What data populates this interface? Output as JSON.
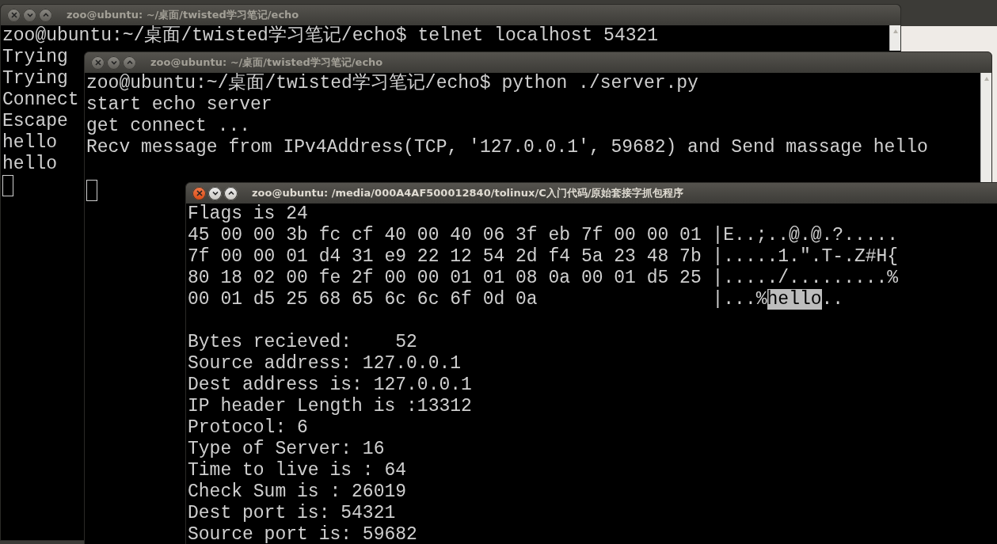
{
  "windows": [
    {
      "title": "zoo@ubuntu: ~/桌面/twisted学习笔记/echo",
      "active": false,
      "lines": [
        {
          "kind": "text",
          "text": "zoo@ubuntu:~/桌面/twisted学习笔记/echo$ telnet localhost 54321"
        },
        {
          "kind": "text",
          "text": "Trying"
        },
        {
          "kind": "text",
          "text": "Trying"
        },
        {
          "kind": "text",
          "text": "Connect"
        },
        {
          "kind": "text",
          "text": "Escape"
        },
        {
          "kind": "text",
          "text": "hello"
        },
        {
          "kind": "text",
          "text": "hello"
        },
        {
          "kind": "cursor"
        }
      ]
    },
    {
      "title": "zoo@ubuntu: ~/桌面/twisted学习笔记/echo",
      "active": false,
      "lines": [
        {
          "kind": "text",
          "text": "zoo@ubuntu:~/桌面/twisted学习笔记/echo$ python ./server.py"
        },
        {
          "kind": "text",
          "text": "start echo server"
        },
        {
          "kind": "text",
          "text": "get connect ..."
        },
        {
          "kind": "text",
          "text": "Recv message from IPv4Address(TCP, '127.0.0.1', 59682) and Send massage hello"
        },
        {
          "kind": "blank"
        },
        {
          "kind": "cursor"
        }
      ]
    },
    {
      "title": "zoo@ubuntu: /media/000A4AF500012840/tolinux/C入门代码/原始套接字抓包程序",
      "active": true,
      "lines": [
        {
          "kind": "text",
          "text": "Flags is 24"
        },
        {
          "kind": "text",
          "text": "45 00 00 3b fc cf 40 00 40 06 3f eb 7f 00 00 01 |E..;..@.@.?....."
        },
        {
          "kind": "text",
          "text": "7f 00 00 01 d4 31 e9 22 12 54 2d f4 5a 23 48 7b |.....1.\".T-.Z#H{"
        },
        {
          "kind": "text",
          "text": "80 18 02 00 fe 2f 00 00 01 01 08 0a 00 01 d5 25 |...../.........%"
        },
        {
          "kind": "segmented",
          "segments": [
            {
              "text": "00 01 d5 25 68 65 6c 6c 6f 0d 0a                |...%",
              "selected": false
            },
            {
              "text": "hello",
              "selected": true
            },
            {
              "text": "..",
              "selected": false
            }
          ]
        },
        {
          "kind": "blank"
        },
        {
          "kind": "text",
          "text": "Bytes recieved:    52"
        },
        {
          "kind": "text",
          "text": "Source address: 127.0.0.1"
        },
        {
          "kind": "text",
          "text": "Dest address is: 127.0.0.1"
        },
        {
          "kind": "text",
          "text": "IP header Length is :13312"
        },
        {
          "kind": "text",
          "text": "Protocol: 6"
        },
        {
          "kind": "text",
          "text": "Type of Server: 16"
        },
        {
          "kind": "text",
          "text": "Time to live is : 64"
        },
        {
          "kind": "text",
          "text": "Check Sum is : 26019"
        },
        {
          "kind": "text",
          "text": "Dest port is: 54321"
        },
        {
          "kind": "text",
          "text": "Source port is: 59682"
        }
      ]
    }
  ]
}
